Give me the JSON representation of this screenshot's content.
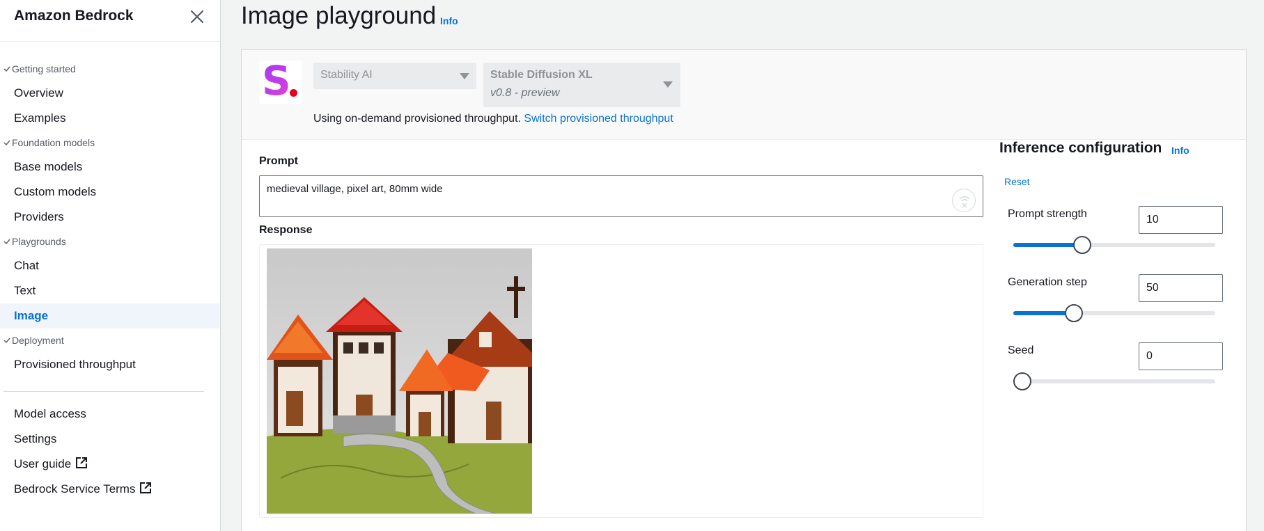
{
  "sidebar": {
    "title": "Amazon Bedrock",
    "sections": [
      {
        "heading": "Getting started",
        "items": [
          "Overview",
          "Examples"
        ]
      },
      {
        "heading": "Foundation models",
        "items": [
          "Base models",
          "Custom models",
          "Providers"
        ]
      },
      {
        "heading": "Playgrounds",
        "items": [
          "Chat",
          "Text",
          "Image"
        ]
      },
      {
        "heading": "Deployment",
        "items": [
          "Provisioned throughput"
        ]
      }
    ],
    "active_item": "Image",
    "footer_items": [
      "Model access",
      "Settings",
      "User guide",
      "Bedrock Service Terms"
    ]
  },
  "page": {
    "title": "Image playground",
    "info": "Info"
  },
  "model": {
    "provider": "Stability AI",
    "name": "Stable Diffusion XL",
    "version": "v0.8 - preview",
    "logo_letter": "S",
    "throughput_text": "Using on-demand provisioned throughput.",
    "throughput_link": "Switch provisioned throughput"
  },
  "prompt": {
    "label": "Prompt",
    "value": "medieval village, pixel art, 80mm wide"
  },
  "response": {
    "label": "Response",
    "image": "generated-image-medieval-village-pixel-art"
  },
  "inference": {
    "title": "Inference configuration",
    "info": "Info",
    "reset": "Reset",
    "params": [
      {
        "label": "Prompt strength",
        "value": "10",
        "slider_fraction": 0.34
      },
      {
        "label": "Generation step",
        "value": "50",
        "slider_fraction": 0.3
      },
      {
        "label": "Seed",
        "value": "0",
        "slider_fraction": 0.0
      }
    ]
  },
  "colors": {
    "accent": "#0972d3",
    "background": "#f2f3f3"
  }
}
